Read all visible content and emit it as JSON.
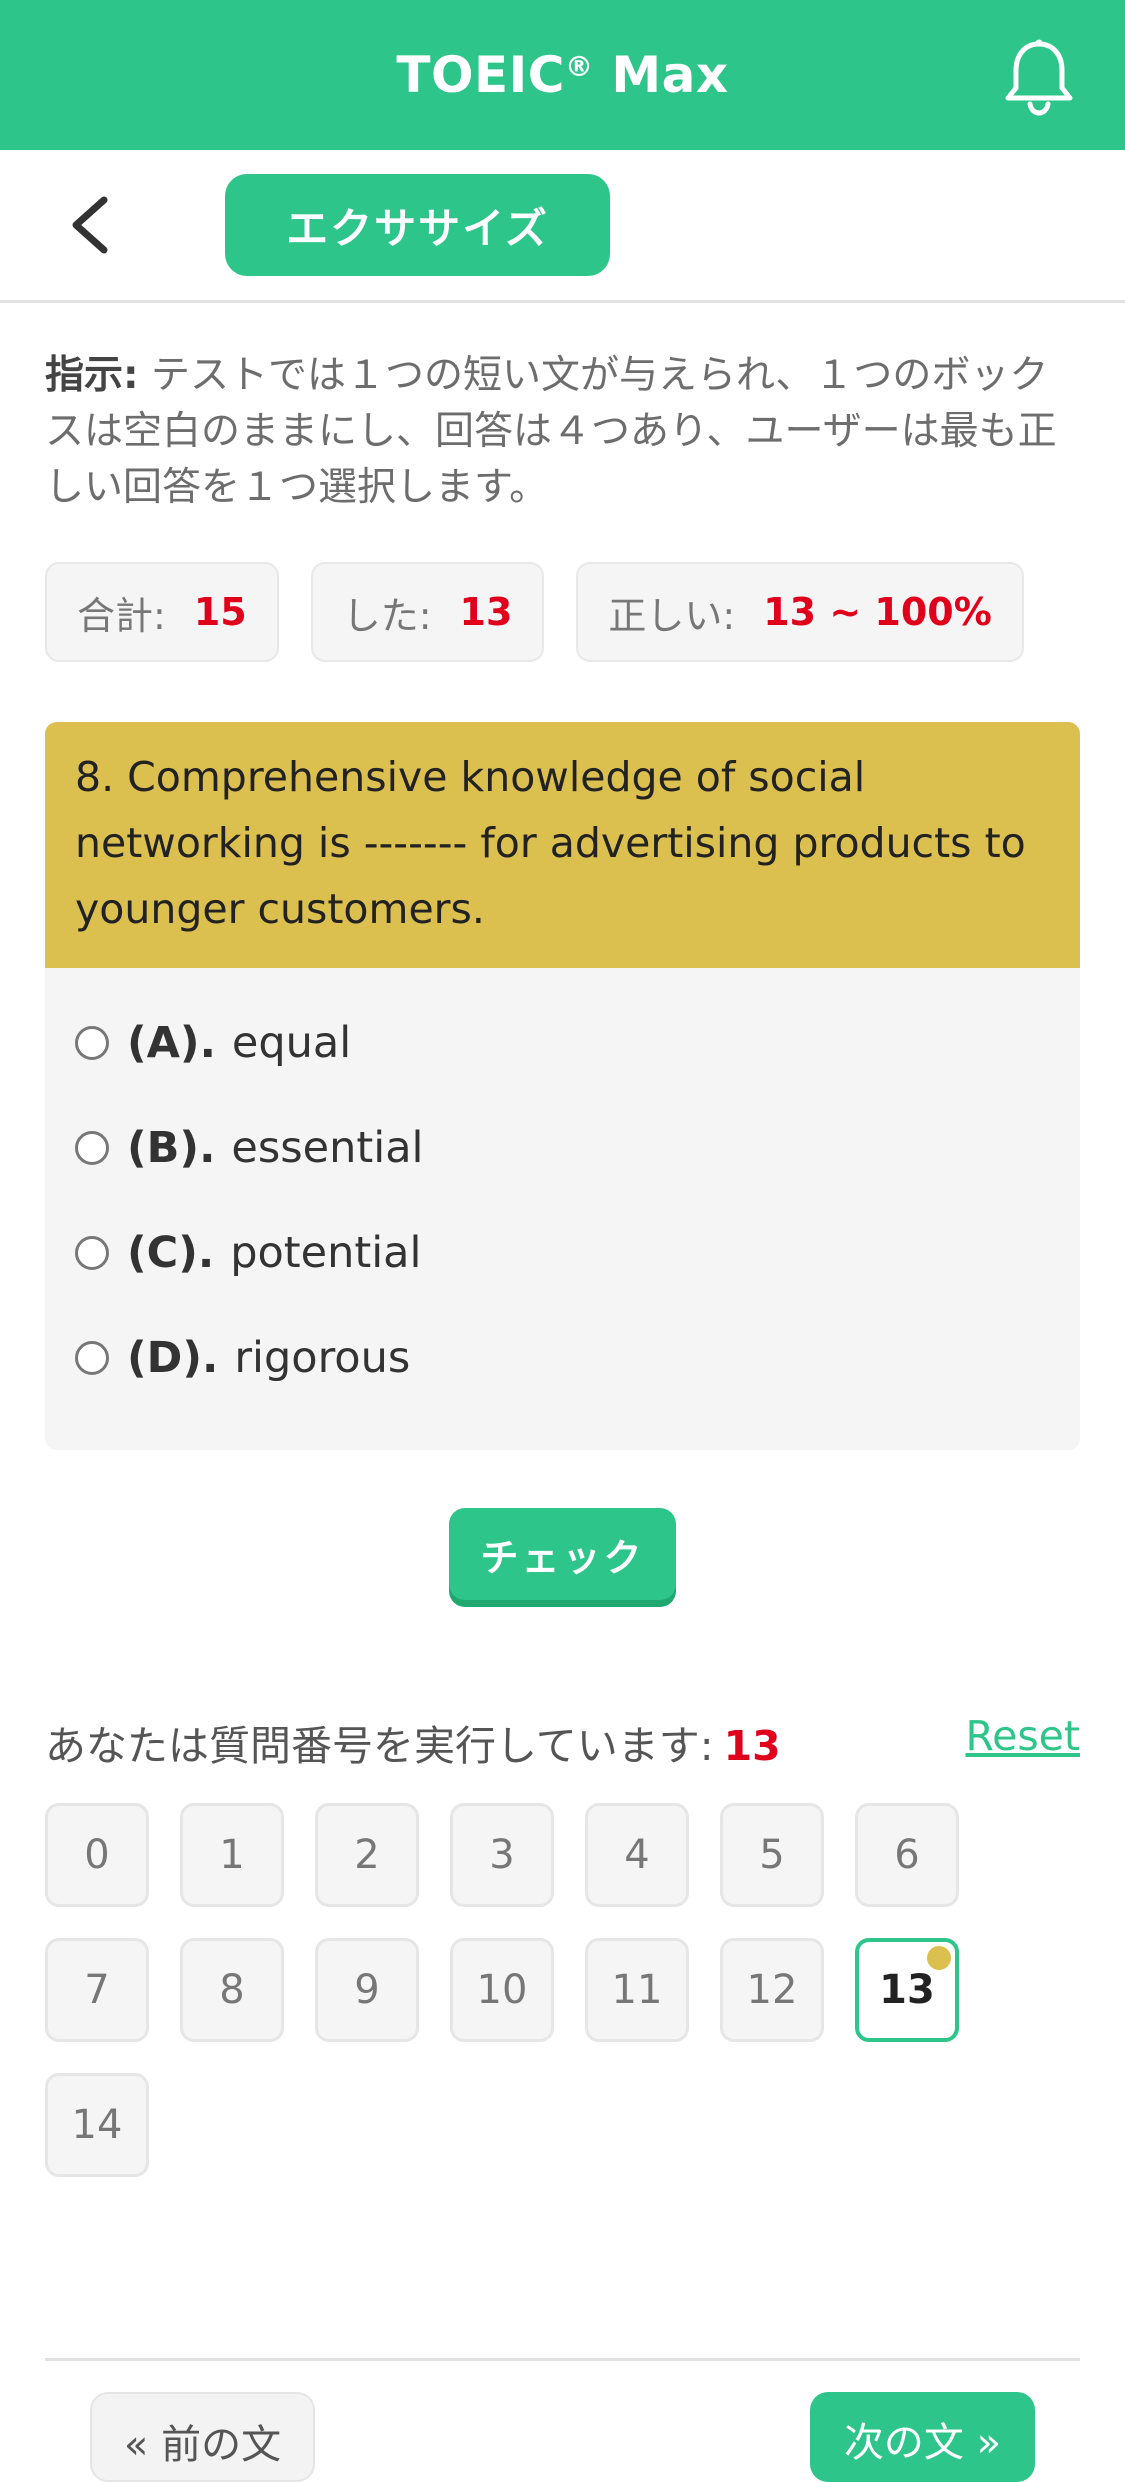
{
  "header": {
    "title": "TOEIC",
    "title_reg": "®",
    "title_suffix": " Max",
    "bell_icon": "bell-icon",
    "accent": "#2dc58a"
  },
  "subbar": {
    "back_icon": "chevron-left-icon",
    "exercise_label": "エクササイズ"
  },
  "instruction": {
    "label": "指示:",
    "text": " テストでは１つの短い文が与えられ、１つのボックスは空白のままにし、回答は４つあり、ユーザーは最も正しい回答を１つ選択します。"
  },
  "stats": {
    "total_label": "合計:",
    "total_value": "15",
    "done_label": "した:",
    "done_value": "13",
    "correct_label": "正しい:",
    "correct_value": "13 ~ 100%"
  },
  "question": {
    "text": "8. Comprehensive knowledge of social networking is ------- for advertising products to younger customers.",
    "options": [
      {
        "letter": "(A).",
        "text": "equal"
      },
      {
        "letter": "(B).",
        "text": "essential"
      },
      {
        "letter": "(C).",
        "text": "potential"
      },
      {
        "letter": "(D).",
        "text": "rigorous"
      }
    ]
  },
  "check_label": "チェック",
  "progress": {
    "label": "あなたは質問番号を実行しています:",
    "current": "13",
    "reset_label": "Reset"
  },
  "question_numbers": [
    "0",
    "1",
    "2",
    "3",
    "4",
    "5",
    "6",
    "7",
    "8",
    "9",
    "10",
    "11",
    "12",
    "13",
    "14"
  ],
  "active_question": "13",
  "nav": {
    "prev_label": "« 前の文",
    "next_label": "次の文 »"
  }
}
